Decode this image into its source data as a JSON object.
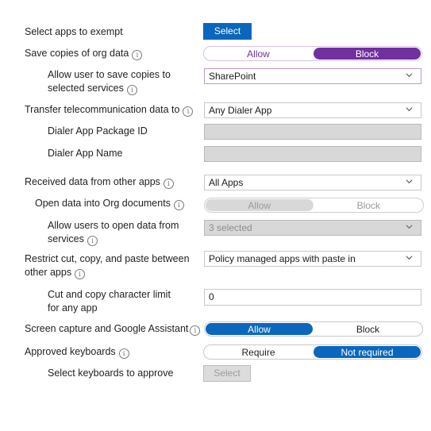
{
  "colors": {
    "primary_blue": "#0a67bd",
    "purple": "#7030a0",
    "disabled_gray": "#d8d8d8"
  },
  "rows": {
    "exempt": {
      "label": "Select apps to exempt",
      "button": "Select"
    },
    "save_copies": {
      "label": "Save copies of org data",
      "info_icon": "info-icon",
      "options": [
        "Allow",
        "Block"
      ],
      "selected": "Block"
    },
    "allow_save": {
      "label_line1": "Allow user to save copies to",
      "label_line2": "selected services",
      "info_icon": "info-icon",
      "value": "SharePoint"
    },
    "transfer_tel": {
      "label": "Transfer telecommunication data to",
      "info_icon": "info-icon",
      "value": "Any Dialer App"
    },
    "dialer_pkg": {
      "label": "Dialer App Package ID",
      "value": ""
    },
    "dialer_name": {
      "label": "Dialer App Name",
      "value": ""
    },
    "received": {
      "label": "Received data from other apps",
      "info_icon": "info-icon",
      "value": "All Apps"
    },
    "open_data": {
      "label": "Open data into Org documents",
      "info_icon": "info-icon",
      "options": [
        "Allow",
        "Block"
      ],
      "selected": "Allow",
      "disabled": true
    },
    "allow_open": {
      "label_line1": "Allow users to open data from",
      "label_line2": "services",
      "info_icon": "info-icon",
      "value": "3 selected",
      "disabled": true
    },
    "restrict_cut": {
      "label_line1": "Restrict cut, copy, and paste between",
      "label_line2": "other apps",
      "info_icon": "info-icon",
      "value": "Policy managed apps with paste in"
    },
    "char_limit": {
      "label_line1": "Cut and copy character limit",
      "label_line2": "for any app",
      "value": "0"
    },
    "screen_capture": {
      "label": "Screen capture and Google Assistant",
      "info_icon": "info-icon",
      "options": [
        "Allow",
        "Block"
      ],
      "selected": "Allow"
    },
    "approved_kb": {
      "label": "Approved keyboards",
      "info_icon": "info-icon",
      "options": [
        "Require",
        "Not required"
      ],
      "selected": "Not required"
    },
    "select_kb": {
      "label": "Select keyboards to approve",
      "button": "Select",
      "disabled": true
    }
  }
}
